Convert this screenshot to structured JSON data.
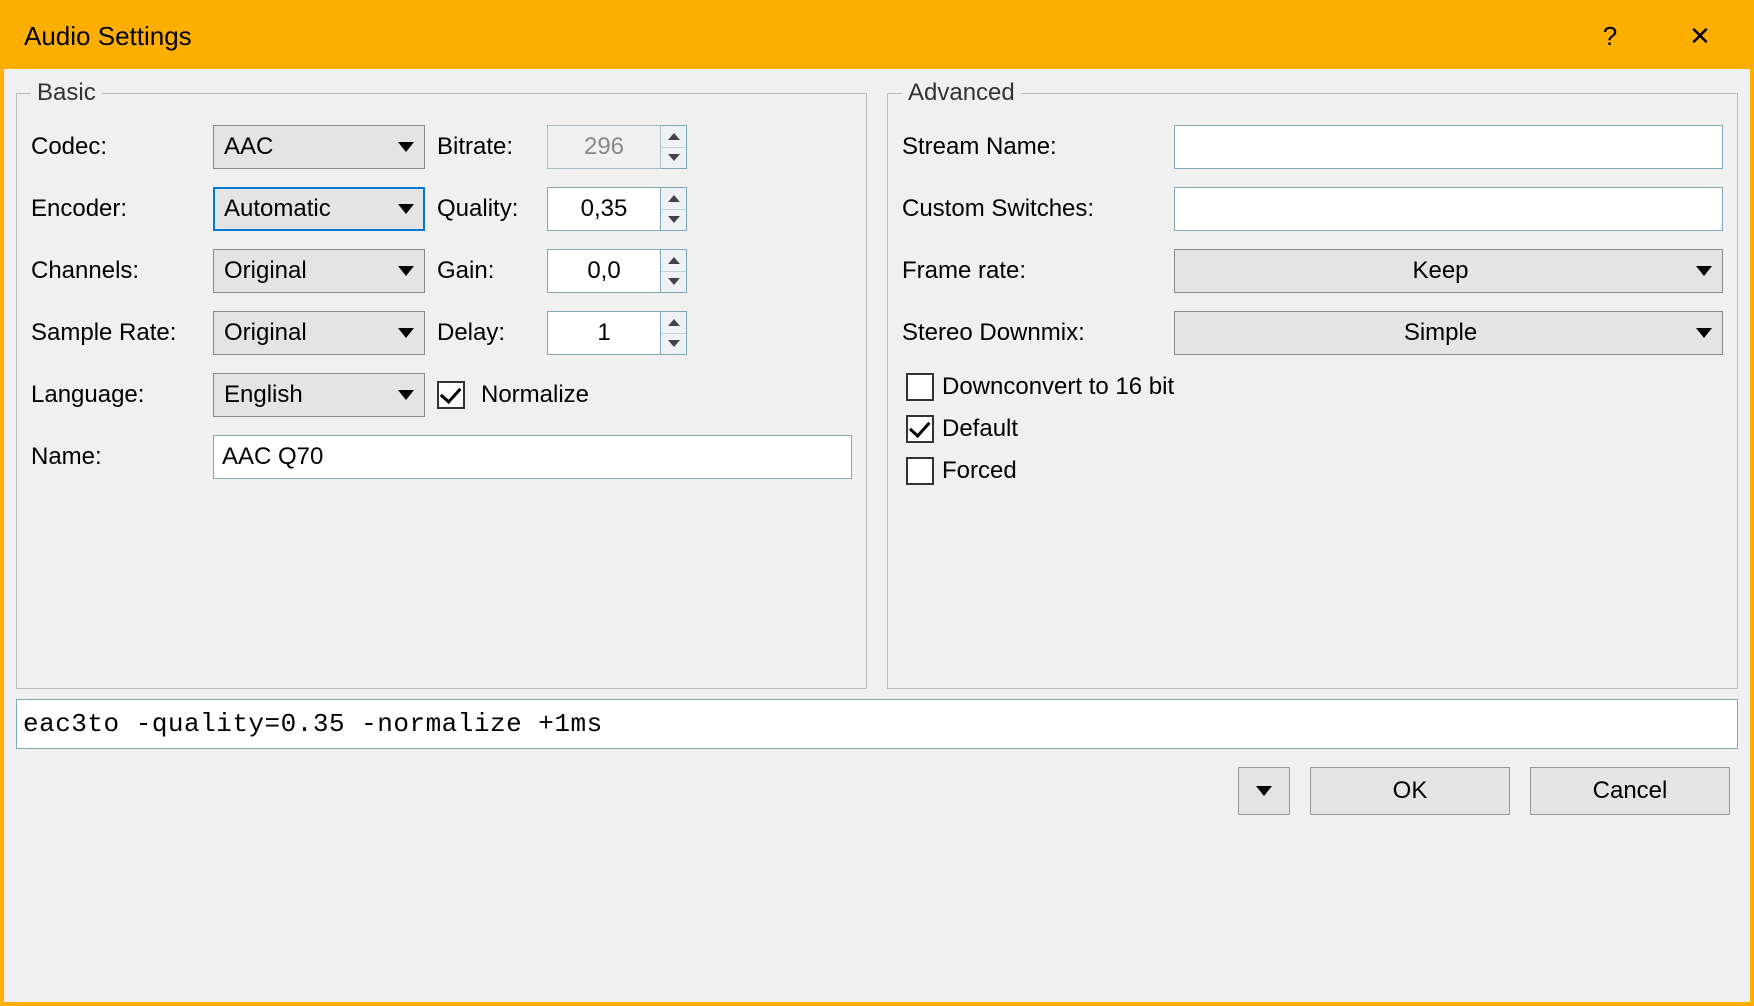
{
  "window": {
    "title": "Audio Settings",
    "help": "?",
    "close": "✕"
  },
  "basic": {
    "legend": "Basic",
    "codec_label": "Codec:",
    "codec_value": "AAC",
    "encoder_label": "Encoder:",
    "encoder_value": "Automatic",
    "channels_label": "Channels:",
    "channels_value": "Original",
    "samplerate_label": "Sample Rate:",
    "samplerate_value": "Original",
    "language_label": "Language:",
    "language_value": "English",
    "name_label": "Name:",
    "name_value": "AAC Q70",
    "bitrate_label": "Bitrate:",
    "bitrate_value": "296",
    "quality_label": "Quality:",
    "quality_value": "0,35",
    "gain_label": "Gain:",
    "gain_value": "0,0",
    "delay_label": "Delay:",
    "delay_value": "1",
    "normalize_label": "Normalize",
    "normalize_checked": true
  },
  "advanced": {
    "legend": "Advanced",
    "stream_name_label": "Stream Name:",
    "stream_name_value": "",
    "custom_switches_label": "Custom Switches:",
    "custom_switches_value": "",
    "framerate_label": "Frame rate:",
    "framerate_value": "Keep",
    "stereo_downmix_label": "Stereo Downmix:",
    "stereo_downmix_value": "Simple",
    "downconvert_label": "Downconvert to 16 bit",
    "downconvert_checked": false,
    "default_label": "Default",
    "default_checked": true,
    "forced_label": "Forced",
    "forced_checked": false
  },
  "commandline": "eac3to -quality=0.35 -normalize +1ms",
  "buttons": {
    "ok": "OK",
    "cancel": "Cancel"
  }
}
